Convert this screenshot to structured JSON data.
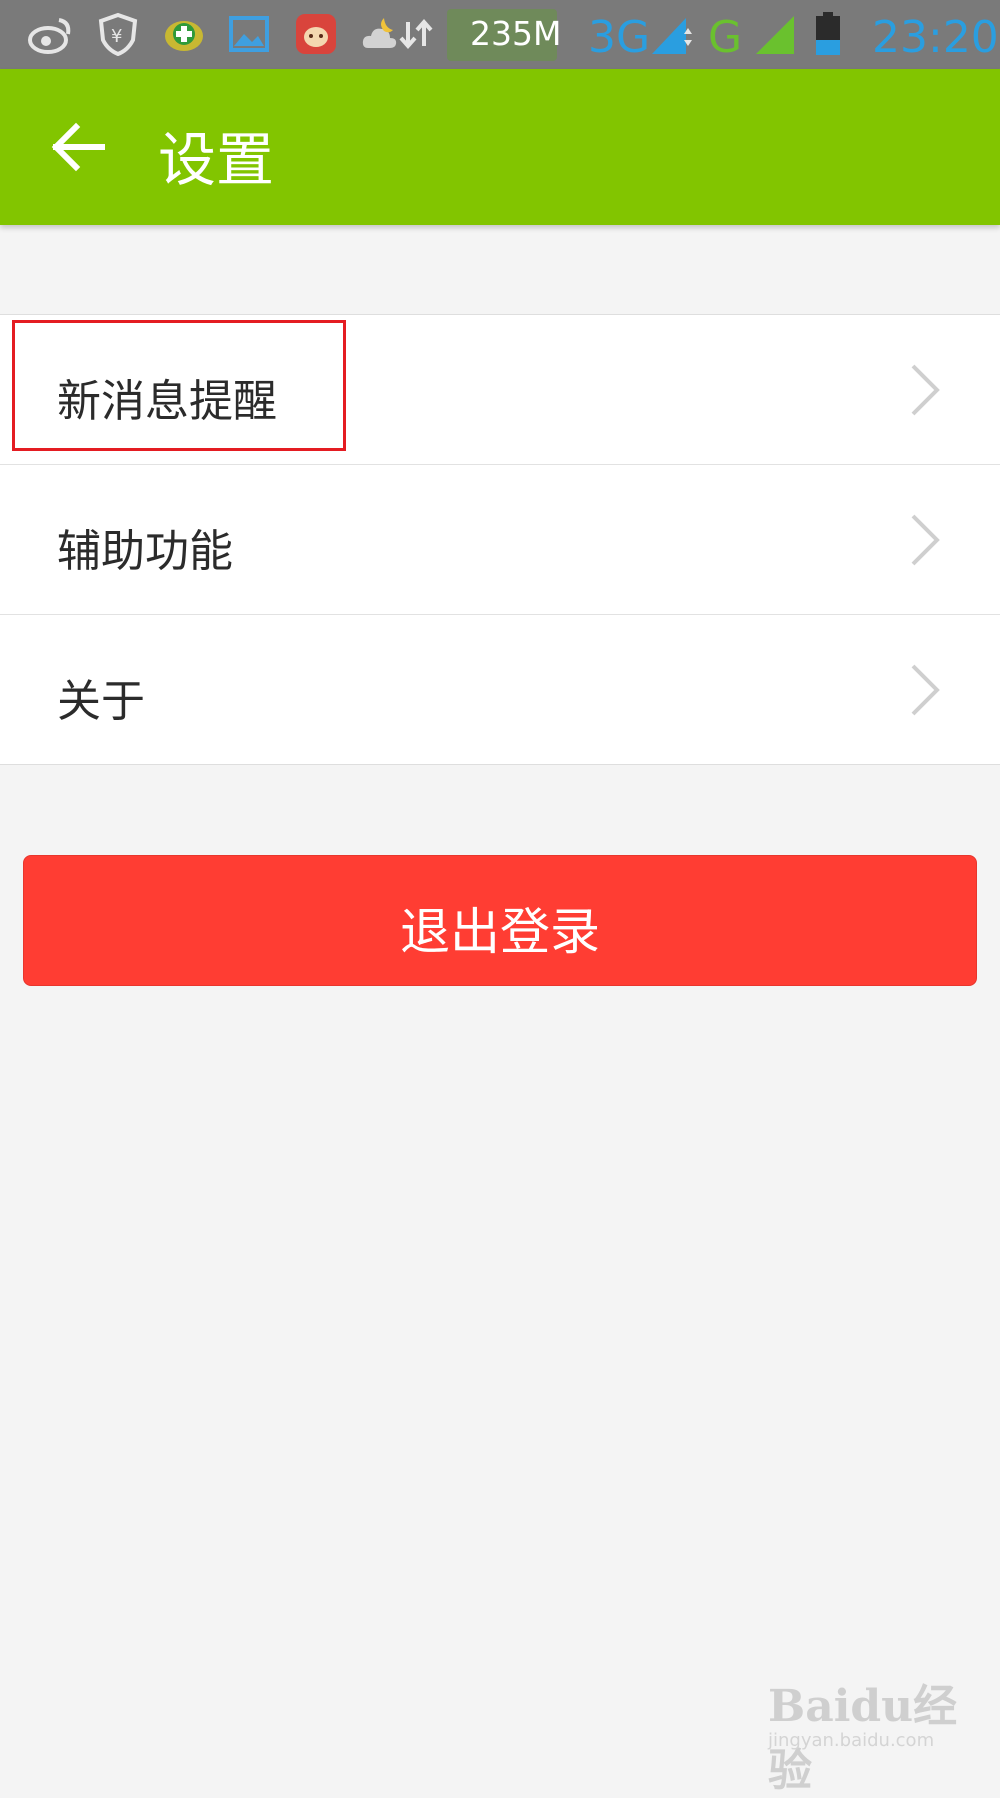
{
  "status_bar": {
    "memory": "235M",
    "network": "3G",
    "network2": "G",
    "time": "23:20",
    "icons": [
      "weibo-icon",
      "shield-yuan-icon",
      "plus-app-icon",
      "gallery-icon",
      "bull-app-icon",
      "weather-icon",
      "sync-arrows-icon",
      "signal-icon",
      "signal-icon",
      "battery-icon"
    ],
    "colors": {
      "bar_bg": "#7a7a7a",
      "network_blue": "#2a9ee0",
      "network_green": "#6ac12e"
    }
  },
  "toolbar": {
    "title": "设置",
    "back_icon": "arrow-left-icon",
    "color": "#82c500"
  },
  "settings": {
    "items": [
      {
        "label": "新消息提醒",
        "icon": "chevron-right-icon"
      },
      {
        "label": "辅助功能",
        "icon": "chevron-right-icon"
      },
      {
        "label": "关于",
        "icon": "chevron-right-icon"
      }
    ]
  },
  "logout": {
    "label": "退出登录",
    "color": "#ff3d33"
  },
  "watermark": {
    "logo": "Baidu经验",
    "url": "jingyan.baidu.com"
  }
}
